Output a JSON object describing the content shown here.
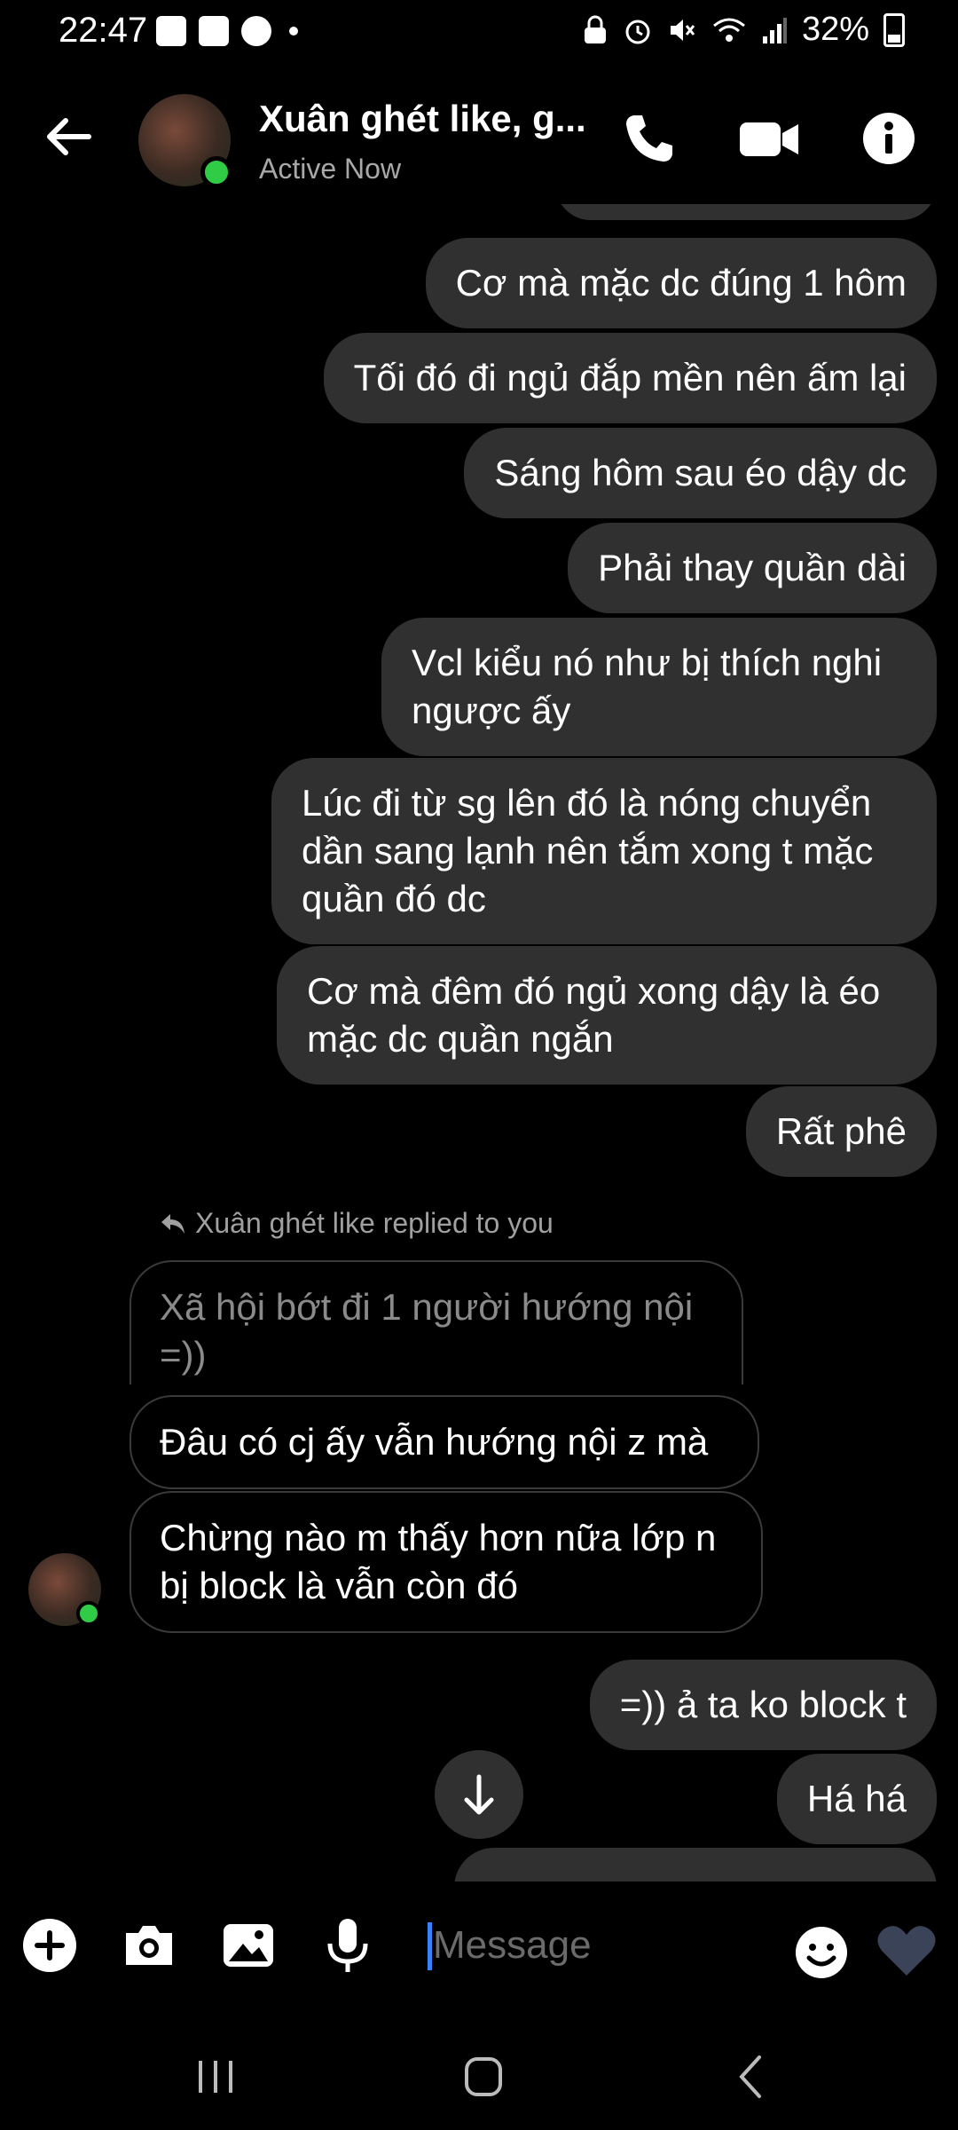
{
  "status_bar": {
    "time": "22:47",
    "battery": "32%",
    "icons": [
      "gallery-icon",
      "game-icon",
      "messenger-icon",
      "dot-icon",
      "lock-icon",
      "alarm-icon",
      "mute-icon",
      "wifi-icon",
      "signal-icon",
      "battery-icon"
    ]
  },
  "header": {
    "name": "Xuân ghét like, g...",
    "status": "Active Now",
    "icons": [
      "back-arrow-icon",
      "phone-icon",
      "video-icon",
      "info-icon"
    ]
  },
  "messages_out_top": [
    "Cơ mà mặc dc đúng 1 hôm",
    "Tối đó đi ngủ đắp mền nên ấm lại",
    "Sáng hôm sau éo dậy dc",
    "Phải thay quần dài",
    "Vcl kiểu nó như bị thích nghi ngược ấy",
    "Lúc đi từ sg lên đó là nóng chuyển dần sang lạnh nên tắm xong t mặc quần đó dc",
    "Cơ mà đêm đó ngủ xong dậy là éo mặc dc quần ngắn",
    "Rất phê"
  ],
  "reply_label": "Xuân ghét like replied to you",
  "reply_quote": "Xã hội bớt đi 1 người hướng nội =))",
  "messages_in": [
    "Đâu có cj ấy vẫn hướng nội z mà",
    "Chừng nào m thấy hơn nữa lớp n bị block là vẫn còn đó"
  ],
  "messages_out_bottom": [
    "=)) ả ta ko block t",
    "Há há"
  ],
  "composer": {
    "placeholder": "Message",
    "icons": [
      "plus-icon",
      "camera-icon",
      "image-icon",
      "mic-icon",
      "emoji-icon",
      "heart-icon"
    ]
  },
  "colors": {
    "background": "#000000",
    "bubble_out": "#303030",
    "bubble_in_border": "#3a3a3a",
    "online": "#31cc46",
    "heart": "#3a4358",
    "caret": "#3b82f6"
  }
}
